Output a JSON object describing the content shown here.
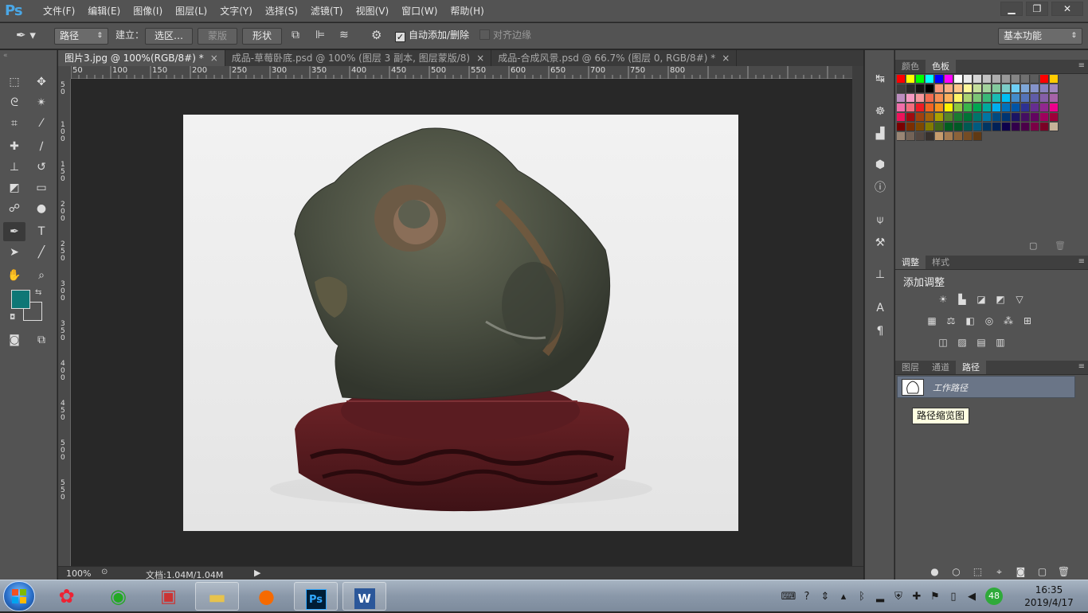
{
  "app": {
    "logo": "Ps",
    "menus": [
      "文件(F)",
      "编辑(E)",
      "图像(I)",
      "图层(L)",
      "文字(Y)",
      "选择(S)",
      "滤镜(T)",
      "视图(V)",
      "窗口(W)",
      "帮助(H)"
    ],
    "window_buttons": {
      "minimize": "▁",
      "restore": "❐",
      "close": "✕"
    }
  },
  "options_bar": {
    "tool_icon": "pen-icon",
    "mode_value": "路径",
    "build_label": "建立：",
    "selection_button": "选区…",
    "mask_button": "蒙版",
    "shape_button": "形状",
    "auto_add_delete_label": "自动添加/删除",
    "auto_add_delete_checked": true,
    "align_edges_label": "对齐边缘",
    "align_edges_checked": false,
    "workspace_value": "基本功能"
  },
  "document_tabs": [
    {
      "label": "图片3.jpg @ 100%(RGB/8#) *",
      "active": true
    },
    {
      "label": "成品-草莓卧底.psd @ 100% (图层 3 副本, 图层蒙版/8)",
      "active": false
    },
    {
      "label": "成品-合成风景.psd @ 66.7% (图层 0, RGB/8#) *",
      "active": false
    }
  ],
  "ruler_top_labels": [
    "50",
    "100",
    "150",
    "200",
    "250",
    "300",
    "350",
    "400",
    "450",
    "500",
    "550",
    "600",
    "650",
    "700",
    "750",
    "800"
  ],
  "ruler_left_labels": [
    "5\n0",
    "1\n0\n0",
    "1\n5\n0",
    "2\n0\n0",
    "2\n5\n0",
    "3\n0\n0",
    "3\n5\n0",
    "4\n0\n0",
    "4\n5\n0",
    "5\n0\n0",
    "5\n5\n0"
  ],
  "status_bar": {
    "zoom": "100%",
    "doc_info": "文档:1.04M/1.04M"
  },
  "colors": {
    "foreground": "#0f7776",
    "background": "#535353",
    "accent": "#4aa7e6"
  },
  "swatches_panel": {
    "tabs": [
      "颜色",
      "色板"
    ],
    "active_tab": "色板",
    "swatches": [
      "#ff0000",
      "#ffff00",
      "#00ff00",
      "#00ffff",
      "#0000ff",
      "#ff00ff",
      "#ffffff",
      "#ebebeb",
      "#d6d6d6",
      "#c2c2c2",
      "#adadad",
      "#999999",
      "#858585",
      "#707070",
      "#5c5c5c",
      "#ff0000",
      "#ffcc00",
      "#3d3d3d",
      "#292929",
      "#141414",
      "#000000",
      "#f7977a",
      "#f9ad81",
      "#fdc68a",
      "#fff79a",
      "#c4df9b",
      "#a2d39c",
      "#82ca9d",
      "#7bcdc8",
      "#6ecff6",
      "#7ea7d8",
      "#8493ca",
      "#8882be",
      "#a187be",
      "#bc8dbf",
      "#f49ac2",
      "#f6989d",
      "#f26c4f",
      "#f68e55",
      "#fbaf5c",
      "#fff467",
      "#acd372",
      "#7cc576",
      "#3bb878",
      "#1abbb4",
      "#00bff3",
      "#438ccb",
      "#5574b9",
      "#605ca8",
      "#855fa8",
      "#a763a8",
      "#f06ea9",
      "#f26d7d",
      "#ed1c24",
      "#f26522",
      "#f7941d",
      "#fff200",
      "#8dc63f",
      "#39b54a",
      "#00a651",
      "#00a99d",
      "#00aeef",
      "#0072bc",
      "#0054a6",
      "#2e3192",
      "#662d91",
      "#92278f",
      "#ec008c",
      "#ed145b",
      "#9e0b0f",
      "#a0410d",
      "#a3620a",
      "#aba000",
      "#598527",
      "#197b30",
      "#007236",
      "#00746b",
      "#0076a3",
      "#004a80",
      "#003471",
      "#1b1464",
      "#440e62",
      "#630460",
      "#9e005d",
      "#9e0039",
      "#790000",
      "#7b2e00",
      "#7d4900",
      "#827b00",
      "#406618",
      "#005e20",
      "#005826",
      "#005952",
      "#005b7f",
      "#003663",
      "#002157",
      "#0d004c",
      "#32004b",
      "#4b0049",
      "#7b0046",
      "#7a0026",
      "#c7b299",
      "#998675",
      "#736357",
      "#534741",
      "#37302d",
      "#c69c6d",
      "#a67c52",
      "#8c6239",
      "#754c24",
      "#603913"
    ]
  },
  "adjustments_panel": {
    "tabs": [
      "调整",
      "样式"
    ],
    "active_tab": "调整",
    "title": "添加调整",
    "row1": [
      "brightness-icon",
      "levels-icon",
      "curves-icon",
      "exposure-icon",
      "vibrance-icon"
    ],
    "row2": [
      "hue-saturation-icon",
      "color-balance-icon",
      "black-white-icon",
      "photo-filter-icon",
      "channel-mixer-icon",
      "color-lookup-icon"
    ],
    "row3": [
      "invert-icon",
      "posterize-icon",
      "threshold-icon",
      "gradient-map-icon"
    ]
  },
  "paths_panel": {
    "tabs": [
      "图层",
      "通道",
      "路径"
    ],
    "active_tab": "路径",
    "work_path_name": "工作路径",
    "tooltip": "路径缩览图"
  },
  "taskbar": {
    "clock_time": "16:35",
    "clock_date": "2019/4/17",
    "badge_count": "48"
  }
}
